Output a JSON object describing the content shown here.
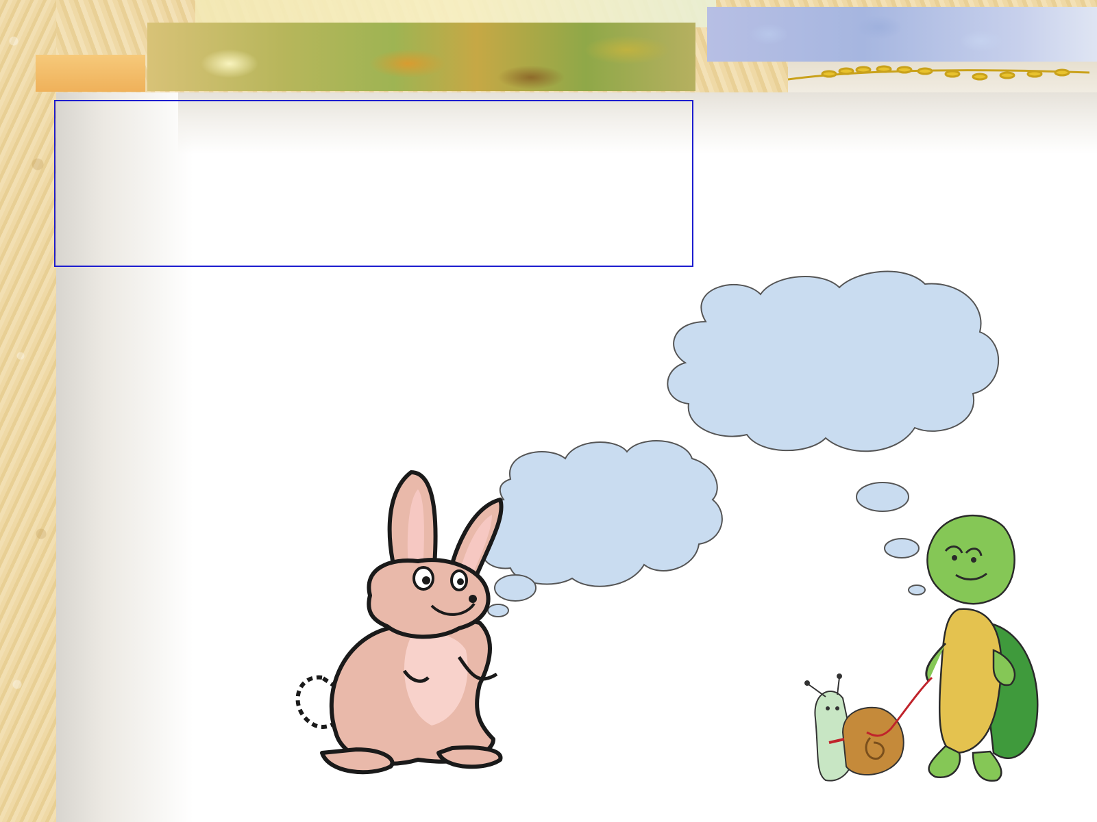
{
  "slide": {
    "title": "",
    "background_accent": "#1c1ccf"
  },
  "characters": {
    "rabbit": {
      "icon": "rabbit-clipart"
    },
    "turtle": {
      "icon": "turtle-clipart"
    },
    "snail": {
      "icon": "snail-clipart"
    }
  },
  "thought_bubbles": {
    "fill": "#c9dcf0",
    "rabbit_text": "",
    "turtle_text": ""
  }
}
